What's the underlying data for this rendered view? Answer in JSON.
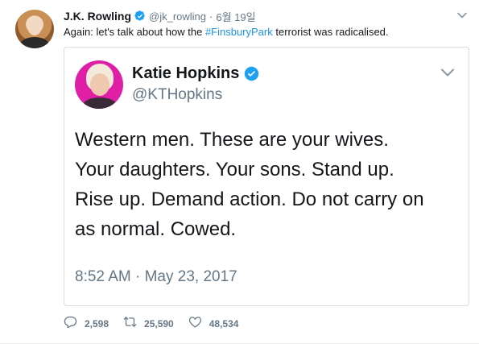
{
  "tweet": {
    "author_name": "J.K. Rowling",
    "author_handle": "@jk_rowling",
    "separator": "·",
    "timestamp": "6월 19일",
    "text_before": "Again: let's talk about how the ",
    "hashtag": "#FinsburyPark",
    "text_after": " terrorist was radicalised."
  },
  "quoted": {
    "author_name": "Katie Hopkins",
    "author_handle": "@KTHopkins",
    "lines": [
      "Western men. These are your wives.",
      "Your daughters. Your sons. Stand up.",
      "Rise up. Demand action. Do not carry on",
      "as normal. Cowed."
    ],
    "timestamp": "8:52 AM · May 23, 2017"
  },
  "actions": {
    "replies": "2,598",
    "retweets": "25,590",
    "likes": "48,534"
  },
  "icons": {
    "verified": "verified-badge-icon",
    "caret": "chevron-down-icon",
    "reply": "reply-icon",
    "retweet": "retweet-icon",
    "like": "heart-icon"
  },
  "colors": {
    "link": "#1b95e0",
    "verified": "#1da1f2",
    "muted": "#657786",
    "text": "#14171a"
  }
}
